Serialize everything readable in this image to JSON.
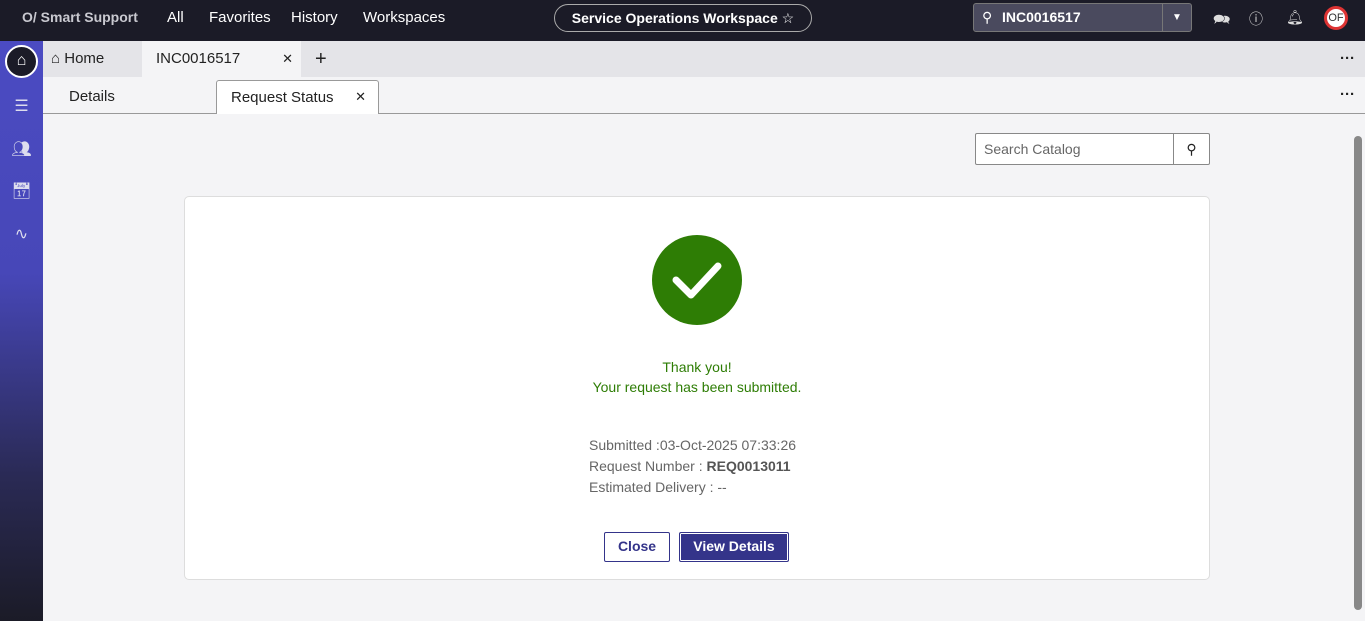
{
  "topbar": {
    "logo": "O/ Smart Support",
    "nav": [
      "All",
      "Favorites",
      "History",
      "Workspaces"
    ],
    "workspace": "Service Operations Workspace",
    "search_value": "INC0016517",
    "avatar": "OF"
  },
  "tabs": {
    "home": "Home",
    "record": "INC0016517"
  },
  "subtabs": {
    "details": "Details",
    "request_status": "Request Status"
  },
  "catalog_search": {
    "placeholder": "Search Catalog"
  },
  "status": {
    "thanks": "Thank you!",
    "message": "Your request has been submitted.",
    "submitted": "Submitted :03-Oct-2025 07:33:26",
    "request_number_label": "Request Number : ",
    "request_number": "REQ0013011",
    "delivery": "Estimated Delivery : --",
    "close": "Close",
    "view": "View Details"
  },
  "colors": {
    "success": "#2e7d05",
    "primary": "#34348a"
  }
}
